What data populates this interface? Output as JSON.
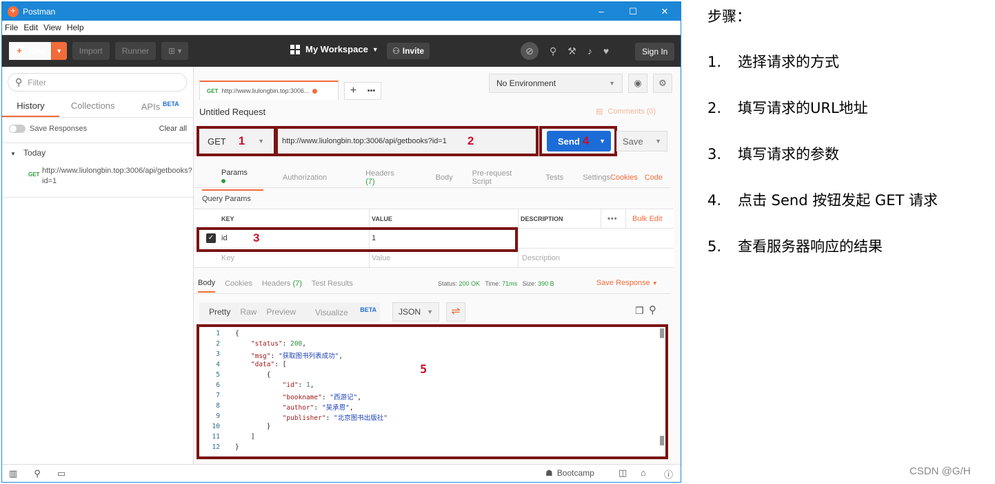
{
  "window": {
    "title": "Postman",
    "minimize": "–",
    "maximize": "☐",
    "close": "✕"
  },
  "menu": [
    "File",
    "Edit",
    "View",
    "Help"
  ],
  "header": {
    "new_label": "New",
    "import_label": "Import",
    "runner_label": "Runner",
    "workspace_label": "My Workspace",
    "invite_label": "Invite",
    "signin_label": "Sign In"
  },
  "sidebar": {
    "filter_placeholder": "Filter",
    "tabs": [
      "History",
      "Collections",
      "APIs"
    ],
    "beta": "BETA",
    "save_responses": "Save Responses",
    "clear_all": "Clear all",
    "group": "Today",
    "history_item": {
      "method": "GET",
      "url": "http://www.liulongbin.top:3006/api/getbooks?id=1"
    }
  },
  "request": {
    "tab_label": "http://www.liulongbin.top:3006...",
    "tab_method": "GET",
    "environment": "No Environment",
    "title": "Untitled Request",
    "comments": "Comments (0)",
    "method": "GET",
    "url": "http://www.liulongbin.top:3006/api/getbooks?id=1",
    "send_label": "Send",
    "save_label": "Save",
    "tabs": {
      "params": "Params",
      "authorization": "Authorization",
      "headers": "Headers",
      "headers_count": "(7)",
      "body": "Body",
      "prerequest": "Pre-request Script",
      "tests": "Tests",
      "settings": "Settings",
      "cookies": "Cookies",
      "code": "Code"
    },
    "query_params_title": "Query Params",
    "columns": {
      "key": "KEY",
      "value": "VALUE",
      "description": "DESCRIPTION",
      "more": "•••",
      "bulk_edit": "Bulk Edit"
    },
    "param_row": {
      "key": "id",
      "value": "1"
    },
    "placeholder_row": {
      "key": "Key",
      "value": "Value",
      "description": "Description"
    }
  },
  "response": {
    "tabs": {
      "body": "Body",
      "cookies": "Cookies",
      "headers": "Headers",
      "headers_count": "(7)",
      "tests": "Test Results"
    },
    "status_label": "Status:",
    "status_value": "200 OK",
    "time_label": "Time:",
    "time_value": "71ms",
    "size_label": "Size:",
    "size_value": "390 B",
    "save_response": "Save Response",
    "formats": [
      "Pretty",
      "Raw",
      "Preview",
      "Visualize"
    ],
    "visualize_beta": "BETA",
    "language": "JSON",
    "lines": [
      {
        "n": "1",
        "text": "{"
      },
      {
        "n": "2",
        "text": "    \"status\": 200,"
      },
      {
        "n": "3",
        "text": "    \"msg\": \"获取图书列表成功\","
      },
      {
        "n": "4",
        "text": "    \"data\": ["
      },
      {
        "n": "5",
        "text": "        {"
      },
      {
        "n": "6",
        "text": "            \"id\": 1,"
      },
      {
        "n": "7",
        "text": "            \"bookname\": \"西游记\","
      },
      {
        "n": "8",
        "text": "            \"author\": \"吴承恩\","
      },
      {
        "n": "9",
        "text": "            \"publisher\": \"北京图书出版社\""
      },
      {
        "n": "10",
        "text": "        }"
      },
      {
        "n": "11",
        "text": "    ]"
      },
      {
        "n": "12",
        "text": "}"
      }
    ]
  },
  "footer": {
    "bootcamp": "Bootcamp"
  },
  "markers": {
    "m1": "1",
    "m2": "2",
    "m3": "3",
    "m4": "4",
    "m5": "5"
  },
  "steps": {
    "heading": "步骤：",
    "items": [
      {
        "n": "1.",
        "text": "选择请求的方式"
      },
      {
        "n": "2.",
        "text": "填写请求的URL地址"
      },
      {
        "n": "3.",
        "text": "填写请求的参数"
      },
      {
        "n": "4.",
        "text": "点击 Send 按钮发起 GET 请求"
      },
      {
        "n": "5.",
        "text": "查看服务器响应的结果"
      }
    ]
  },
  "credit": "CSDN @G/H",
  "colors": {
    "accent": "#f26b3a",
    "send": "#1c6cd8",
    "titlebar": "#1c87d6",
    "annotation": "#7b1414",
    "marker": "#c8102e"
  }
}
